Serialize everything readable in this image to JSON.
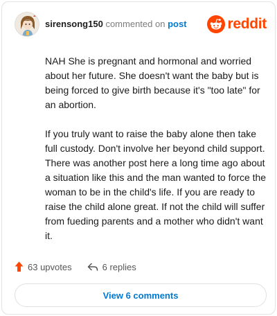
{
  "brand": {
    "name": "reddit",
    "color": "#ff4500"
  },
  "header": {
    "username": "sirensong150",
    "action": "commented on",
    "target": "post"
  },
  "comment": {
    "paragraphs": [
      "NAH She is pregnant and hormonal and worried about her future. She doesn't want the baby but is being forced to give birth because it's \"too late\" for an abortion.",
      "If you truly want to raise the baby alone then take full custody. Don't involve her beyond child support. There was another post here a long time ago about a situation like this and the man wanted to force the woman to be in the child's life. If you are ready to raise the child alone great. If not the child will suffer from fueding parents and a mother who didn't want it."
    ]
  },
  "stats": {
    "upvotes": "63 upvotes",
    "replies": "6 replies"
  },
  "view_button": {
    "label": "View 6 comments"
  },
  "colors": {
    "link": "#0079d3",
    "upvote": "#ff4500",
    "muted": "#7c7c7c"
  },
  "icons": [
    "avatar",
    "reddit-logo-icon",
    "upvote-arrow-icon",
    "reply-arrow-icon"
  ]
}
